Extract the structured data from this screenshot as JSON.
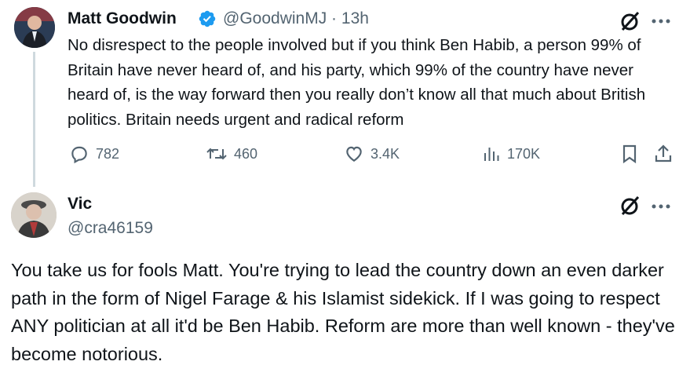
{
  "tweet": {
    "author_name": "Matt Goodwin",
    "handle": "@GoodwinMJ",
    "separator": "·",
    "time": "13h",
    "text": "No disrespect to the people involved but if you think Ben Habib, a person 99% of Britain have never heard of, and his party, which 99% of the country have never heard of, is the way forward then you really don’t know all that much about British politics. Britain needs urgent and radical reform",
    "replies": "782",
    "reposts": "460",
    "likes": "3.4K",
    "views": "170K"
  },
  "reply": {
    "author_name": "Vic",
    "handle": "@cra46159",
    "text": "You take us for fools Matt. You're trying to lead the country down an even darker path in the form of Nigel Farage & his Islamist sidekick. If I was going to respect ANY politician at all it'd be Ben Habib. Reform are more than well known - they've become notorious."
  },
  "icons": {
    "verified": "verified-badge-icon",
    "grok": "grok-icon",
    "more": "more-icon",
    "reply": "reply-icon",
    "repost": "repost-icon",
    "like": "like-icon",
    "views": "views-icon",
    "bookmark": "bookmark-icon",
    "share": "share-icon"
  },
  "colors": {
    "verified": "#1d9bf0",
    "muted": "#536471",
    "text": "#0f1419"
  }
}
